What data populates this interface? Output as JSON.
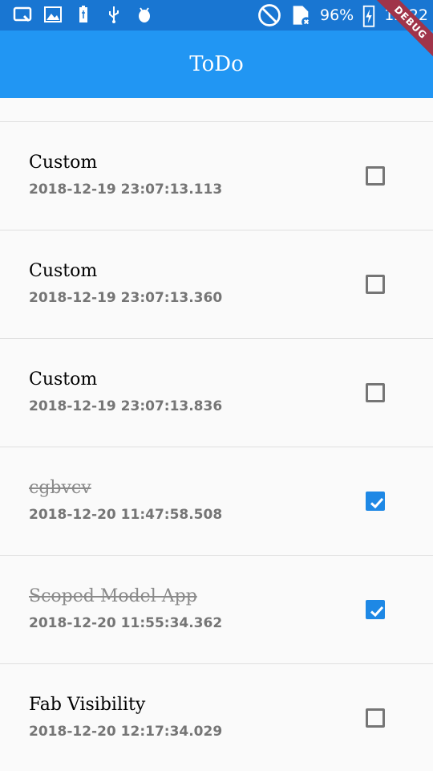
{
  "status_bar": {
    "battery": "96%",
    "time": "12:22"
  },
  "debug_banner": "DEBUG",
  "app_bar": {
    "title": "ToDo"
  },
  "todos": [
    {
      "title": "Custom",
      "date": "2018-12-19 23:07:13.113",
      "done": false
    },
    {
      "title": "Custom",
      "date": "2018-12-19 23:07:13.360",
      "done": false
    },
    {
      "title": "Custom",
      "date": "2018-12-19 23:07:13.836",
      "done": false
    },
    {
      "title": "cgbvcv",
      "date": "2018-12-20 11:47:58.508",
      "done": true
    },
    {
      "title": "Scoped Model App",
      "date": "2018-12-20 11:55:34.362",
      "done": true
    },
    {
      "title": "Fab Visibility",
      "date": "2018-12-20 12:17:34.029",
      "done": false
    }
  ],
  "colors": {
    "status_bar": "#1976d2",
    "app_bar": "#2196f3",
    "checkbox_checked": "#1e88e5"
  }
}
